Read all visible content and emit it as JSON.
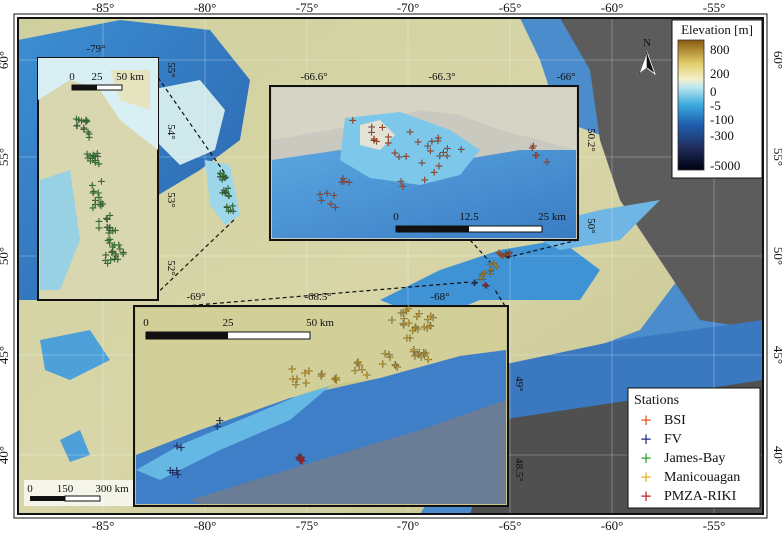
{
  "lon_ticks": [
    "-85°",
    "-80°",
    "-75°",
    "-70°",
    "-65°",
    "-60°",
    "-55°"
  ],
  "lat_ticks": [
    "60°",
    "55°",
    "50°",
    "45°",
    "40°"
  ],
  "colorbar": {
    "title": "Elevation [m]",
    "labels": [
      "800",
      "200",
      "0",
      "-5",
      "-100",
      "-300",
      "-5000"
    ]
  },
  "north_label": "N",
  "main_scale": {
    "labels": [
      "0",
      "150",
      "300 km"
    ]
  },
  "inset_james": {
    "lon_ticks": [
      "-79°"
    ],
    "lat_ticks": [
      "55°",
      "54°",
      "53°",
      "52°"
    ],
    "scale_labels": [
      "0",
      "25",
      "50 km"
    ]
  },
  "inset_bsi": {
    "lon_ticks": [
      "-66.6°",
      "-66.3°",
      "-66°"
    ],
    "lat_ticks": [
      "50.2°",
      "50°"
    ],
    "scale_labels": [
      "0",
      "12.5",
      "25 km"
    ]
  },
  "inset_st": {
    "lon_ticks": [
      "-69°",
      "-68.5°",
      "-68°"
    ],
    "lat_ticks": [
      "49°",
      "48.5°"
    ],
    "scale_labels": [
      "0",
      "25",
      "50 km"
    ]
  },
  "legend": {
    "title": "Stations",
    "items": [
      {
        "label": "BSI",
        "color": "#e8531f"
      },
      {
        "label": "FV",
        "color": "#1d2a8a"
      },
      {
        "label": "James-Bay",
        "color": "#2ea02e"
      },
      {
        "label": "Manicouagan",
        "color": "#e6b422"
      },
      {
        "label": "PMZA-RIKI",
        "color": "#c0202a"
      }
    ]
  },
  "colors": {
    "deep_ocean": "#2f6fb8",
    "ocean": "#3b8fd0",
    "shelf": "#8fd0e8",
    "land_low": "#d8d8a8",
    "land_high": "#c8b070",
    "dark": "#3a3a3a"
  }
}
